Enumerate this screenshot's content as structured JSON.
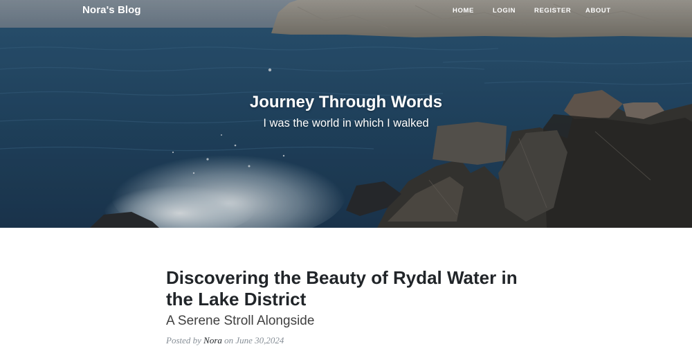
{
  "navbar": {
    "brand": "Nora's Blog",
    "links": {
      "home": "HOME",
      "login": "LOGIN",
      "register": "REGISTER",
      "about": "ABOUT"
    }
  },
  "hero": {
    "heading": "Journey Through Words",
    "subheading": "I was the world in which I walked"
  },
  "post": {
    "title": "Discovering the Beauty of Rydal Water in the Lake District",
    "subtitle": "A Serene Stroll Alongside",
    "meta": {
      "posted_by": "Posted by",
      "author": "Nora",
      "on": "on",
      "date": "June 30,2024"
    }
  },
  "colors": {
    "sea": "#2a4d6e",
    "rock": "#3a3835",
    "title_text": "#212529",
    "meta_text": "#868e96"
  }
}
